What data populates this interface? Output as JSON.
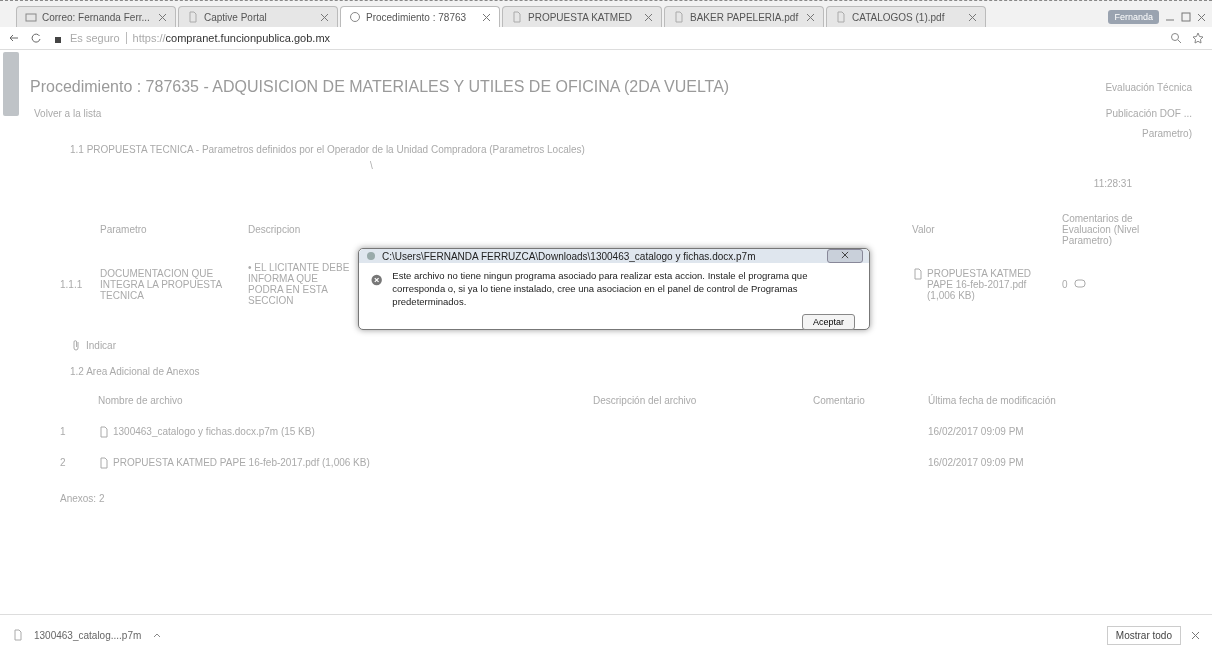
{
  "tabs": [
    {
      "label": "Correo: Fernanda Ferr...",
      "selected": false,
      "kind": "mail"
    },
    {
      "label": "Captive Portal",
      "selected": false,
      "kind": "doc"
    },
    {
      "label": "Procedimiento : 78763",
      "selected": true,
      "kind": "web"
    },
    {
      "label": "PROPUESTA KATMED",
      "selected": false,
      "kind": "doc"
    },
    {
      "label": "BAKER PAPELERIA.pdf",
      "selected": false,
      "kind": "doc"
    },
    {
      "label": "CATALOGOS (1).pdf",
      "selected": false,
      "kind": "doc"
    }
  ],
  "window_user": "Fernanda",
  "address_bar": {
    "security": "Es seguro",
    "scheme": "https://",
    "host": "compranet.funcionpublica.gob.mx"
  },
  "page": {
    "title": "Procedimiento : 787635 - ADQUISICION DE MATERIALES Y UTILES DE OFICINA (2DA VUELTA)",
    "evaluation_link": "Evaluación Técnica",
    "back_link": "Volver a la lista",
    "publication_link": "Publicación DOF",
    "more": "...",
    "section_1": {
      "heading": "1.1 PROPUESTA TECNICA - Parametros definidos por el Operador de la Unidad Compradora (Parametros Locales)",
      "header_fragment": "Parametro)",
      "mark": "\\",
      "time": "11:28:31",
      "columns": [
        "Parametro",
        "Descripcion",
        "Valor",
        "Comentarios de Evaluacion (Nivel Parametro)"
      ],
      "rows": [
        {
          "number": "1.1.1",
          "parameter": "DOCUMENTACION QUE INTEGRA LA PROPUESTA TECNICA",
          "description": "• EL LICITANTE DEBE INFORMA QUE PODRA EN ESTA SECCION",
          "value": "PROPUESTA KATMED PAPE 16-feb-2017.pdf (1,006 KB)",
          "comments": "0"
        }
      ],
      "attach_link": "Indicar"
    },
    "section_2": {
      "heading": "1.2 Area Adicional de Anexos",
      "columns": [
        "Nombre de archivo",
        "Descripción del archivo",
        "Comentario",
        "Última fecha de modificación"
      ],
      "rows": [
        {
          "number": "1",
          "file": "1300463_catalogo y fichas.docx.p7m (15 KB)",
          "date": "16/02/2017 09:09 PM"
        },
        {
          "number": "2",
          "file": "PROPUESTA KATMED PAPE 16-feb-2017.pdf (1,006 KB)",
          "date": "16/02/2017 09:09 PM"
        }
      ],
      "count": "Anexos: 2"
    }
  },
  "dialog": {
    "title": "C:\\Users\\FERNANDA FERRUZCA\\Downloads\\1300463_catalogo y fichas.docx.p7m",
    "message": "Este archivo no tiene ningun programa asociado para realizar esta accion. Instale el programa que corresponda o, si ya lo tiene instalado, cree una asociacion en el panel de control de Programas predeterminados.",
    "button": "Aceptar"
  },
  "downloads": {
    "file": "1300463_catalog....p7m",
    "show_all": "Mostrar todo"
  }
}
